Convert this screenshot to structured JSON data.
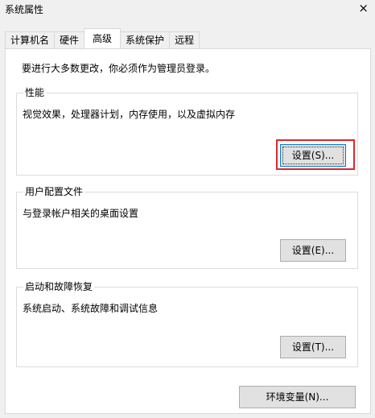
{
  "window": {
    "title": "系统属性",
    "close_glyph": "×"
  },
  "tabs": [
    {
      "label": "计算机名",
      "active": false
    },
    {
      "label": "硬件",
      "active": false
    },
    {
      "label": "高级",
      "active": true
    },
    {
      "label": "系统保护",
      "active": false
    },
    {
      "label": "远程",
      "active": false
    }
  ],
  "advanced": {
    "admin_notice": "要进行大多数更改，你必须作为管理员登录。",
    "performance": {
      "title": "性能",
      "description": "视觉效果，处理器计划，内存使用，以及虚拟内存",
      "button_label": "设置(S)..."
    },
    "user_profiles": {
      "title": "用户配置文件",
      "description": "与登录帐户相关的桌面设置",
      "button_label": "设置(E)..."
    },
    "startup_recovery": {
      "title": "启动和故障恢复",
      "description": "系统启动、系统故障和调试信息",
      "button_label": "设置(T)..."
    },
    "env_vars_button_label": "环境变量(N)..."
  },
  "colors": {
    "highlight": "#e0272b",
    "window_bg": "#f0f0f0",
    "panel_bg": "#ffffff"
  }
}
